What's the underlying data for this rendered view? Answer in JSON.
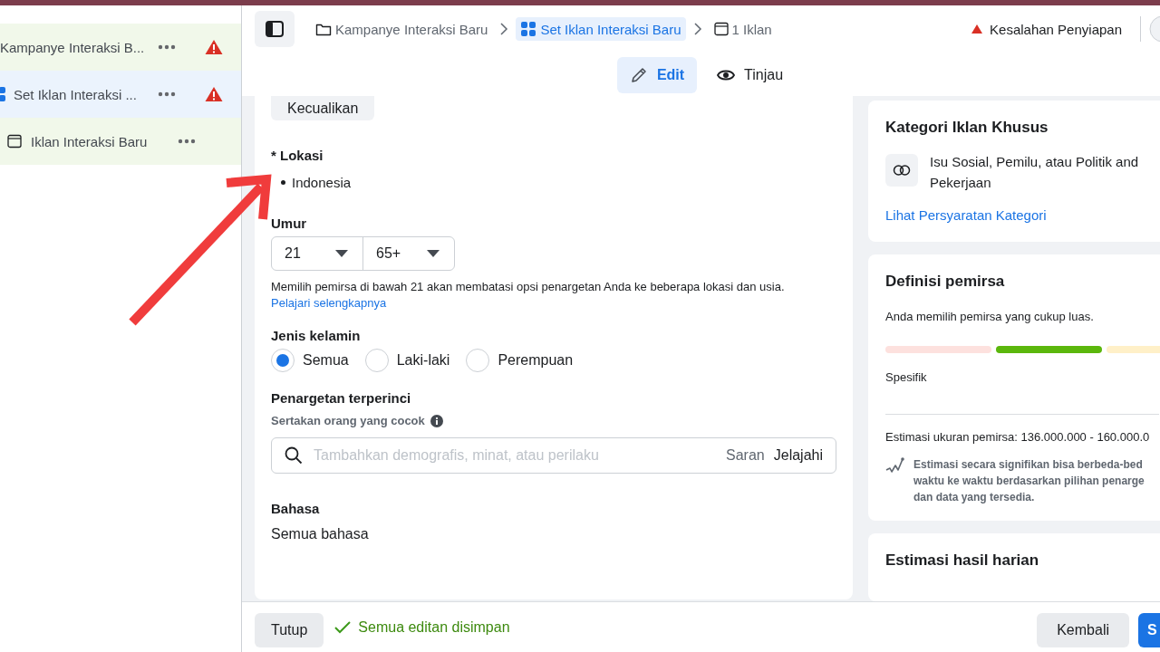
{
  "sidebar": {
    "items": [
      {
        "label": "Kampanye Interaksi B...",
        "kind": "campaign",
        "selected": false,
        "warning": true
      },
      {
        "label": "Set Iklan Interaksi ...",
        "kind": "adset",
        "selected": true,
        "warning": true
      },
      {
        "label": "Iklan Interaksi Baru",
        "kind": "ad",
        "selected": false,
        "warning": false
      }
    ]
  },
  "breadcrumbs": [
    {
      "label": "Kampanye Interaksi Baru",
      "kind": "campaign",
      "selected": false
    },
    {
      "label": "Set Iklan Interaksi Baru",
      "kind": "adset",
      "selected": true
    },
    {
      "label": "1 Iklan",
      "kind": "ad",
      "selected": false
    }
  ],
  "status": {
    "label": "Kesalahan Penyiapan"
  },
  "mode_tabs": [
    {
      "label": "Edit",
      "kind": "edit",
      "selected": true
    },
    {
      "label": "Tinjau",
      "kind": "view",
      "selected": false
    }
  ],
  "form": {
    "exclude_button": "Kecualikan",
    "location": {
      "label": "* Lokasi",
      "items": [
        "Indonesia"
      ]
    },
    "age": {
      "label": "Umur",
      "selects": [
        "21",
        "65+"
      ],
      "note": "Memilih pemirsa di bawah 21 akan membatasi opsi penargetan Anda ke beberapa lokasi dan usia.",
      "link": "Pelajari selengkapnya"
    },
    "gender": {
      "label": "Jenis kelamin",
      "options": [
        {
          "label": "Semua",
          "selected": true
        },
        {
          "label": "Laki-laki",
          "selected": false
        },
        {
          "label": "Perempuan",
          "selected": false
        }
      ]
    },
    "detailed": {
      "label": "Penargetan terperinci",
      "sublabel": "Sertakan orang yang cocok",
      "placeholder": "Tambahkan demografis, minat, atau perilaku",
      "suggest": "Saran",
      "browse": "Jelajahi"
    },
    "language": {
      "label": "Bahasa",
      "value": "Semua bahasa"
    }
  },
  "special_category": {
    "title": "Kategori Iklan Khusus",
    "text": "Isu Sosial, Pemilu, atau Politik and Pekerjaan",
    "link": "Lihat Persyaratan Kategori"
  },
  "audience": {
    "title": "Definisi pemirsa",
    "text": "Anda memilih pemirsa yang cukup luas.",
    "segments": [
      {
        "color": "#fde1de"
      },
      {
        "color": "#5bb70c"
      },
      {
        "color": "#fff0c8"
      }
    ],
    "meter_label": "Spesifik",
    "estimate": "Estimasi ukuran pemirsa: 136.000.000 - 160.000.0",
    "disclaimer": "Estimasi secara signifikan bisa berbeda-bed\nwaktu ke waktu berdasarkan pilihan penarge\ndan data yang tersedia."
  },
  "daily_results": {
    "title": "Estimasi hasil harian"
  },
  "footer": {
    "close": "Tutup",
    "saved": "Semua editan disimpan",
    "back": "Kembali",
    "next": "S"
  }
}
